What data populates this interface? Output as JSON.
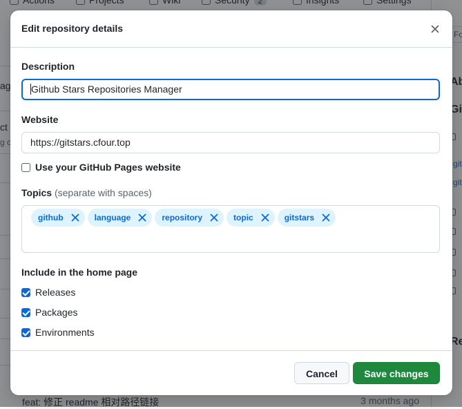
{
  "background": {
    "tabs": [
      {
        "label": "Actions"
      },
      {
        "label": "Projects"
      },
      {
        "label": "Wiki"
      },
      {
        "label": "Security",
        "badge": "2"
      },
      {
        "label": "Insights"
      },
      {
        "label": "Settings"
      }
    ],
    "left_fragments": [
      "ag",
      "ct",
      "g c"
    ],
    "right_fragments": [
      "Abo",
      "Gith",
      "git",
      "git",
      "Rel"
    ],
    "right_input_fragment": "Fo",
    "commit_message": "feat: 修正 readme 相对路径链接",
    "commit_time": "3 months ago"
  },
  "dialog": {
    "title": "Edit repository details",
    "close_icon": "x-icon",
    "description": {
      "label": "Description",
      "value": "Github Stars Repositories Manager"
    },
    "website": {
      "label": "Website",
      "value": "https://gitstars.cfour.top"
    },
    "pages_checkbox": {
      "label": "Use your GitHub Pages website",
      "checked": false
    },
    "topics": {
      "label": "Topics",
      "hint": "(separate with spaces)",
      "items": [
        "github",
        "language",
        "repository",
        "topic",
        "gitstars"
      ]
    },
    "home_page": {
      "label": "Include in the home page",
      "options": [
        {
          "label": "Releases",
          "checked": true
        },
        {
          "label": "Packages",
          "checked": true
        },
        {
          "label": "Environments",
          "checked": true
        }
      ]
    },
    "buttons": {
      "cancel": "Cancel",
      "save": "Save changes"
    },
    "colors": {
      "accent": "#0969da",
      "primary_button": "#1f883d",
      "topic_bg": "#ddf4ff"
    }
  }
}
